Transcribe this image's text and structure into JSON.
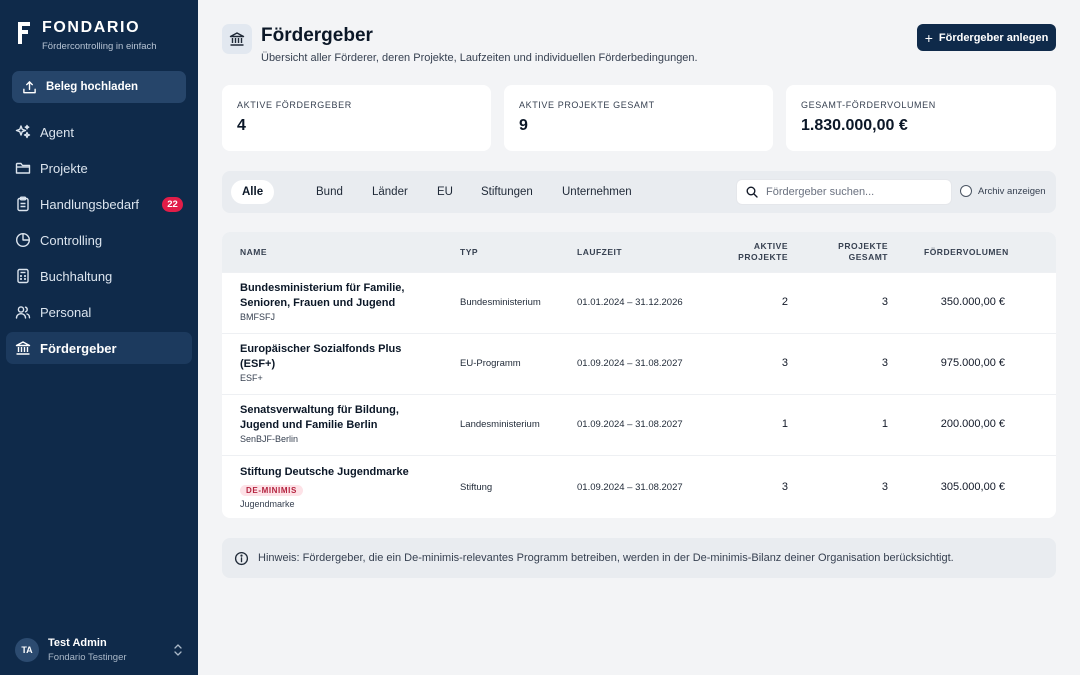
{
  "app": {
    "brand_name": "FONDARIO",
    "brand_tagline": "Fördercontrolling in einfach"
  },
  "sidebar": {
    "upload_label": "Beleg hochladen",
    "items": [
      {
        "label": "Agent",
        "icon": "sparkles-icon"
      },
      {
        "label": "Projekte",
        "icon": "folder-icon"
      },
      {
        "label": "Handlungsbedarf",
        "icon": "clipboard-icon",
        "badge": "22"
      },
      {
        "label": "Controlling",
        "icon": "pie-chart-icon"
      },
      {
        "label": "Buchhaltung",
        "icon": "calculator-icon"
      },
      {
        "label": "Personal",
        "icon": "users-icon"
      },
      {
        "label": "Fördergeber",
        "icon": "bank-icon",
        "active": true
      }
    ],
    "user": {
      "initials": "TA",
      "name": "Test Admin",
      "org": "Fondario Testinger"
    }
  },
  "header": {
    "title": "Fördergeber",
    "subtitle": "Übersicht aller Förderer, deren Projekte, Laufzeiten und individuellen Förderbedingungen.",
    "add_button": "Fördergeber anlegen"
  },
  "stats": [
    {
      "label": "Aktive Fördergeber",
      "value": "4"
    },
    {
      "label": "Aktive Projekte gesamt",
      "value": "9"
    },
    {
      "label": "Gesamt-Fördervolumen",
      "value": "1.830.000,00 €"
    }
  ],
  "filters": {
    "tabs": [
      "Alle",
      "Bund",
      "Länder",
      "EU",
      "Stiftungen",
      "Unternehmen"
    ],
    "active_tab": "Alle",
    "search_placeholder": "Fördergeber suchen...",
    "search_value": "",
    "archive_label": "Archiv anzeigen",
    "archive_checked": false
  },
  "table": {
    "columns": {
      "name": "Name",
      "typ": "Typ",
      "laufzeit": "Laufzeit",
      "aktive_projekte_1": "Aktive",
      "aktive_projekte_2": "Projekte",
      "projekte_gesamt_1": "Projekte",
      "projekte_gesamt_2": "gesamt",
      "volumen": "Fördervolumen"
    },
    "rows": [
      {
        "name_line1": "Bundesministerium für Familie,",
        "name_line2": "Senioren, Frauen und Jugend",
        "badge": "",
        "abbr": "BMFSFJ",
        "typ": "Bundesministerium",
        "laufzeit": "01.01.2024 – 31.12.2026",
        "aktive": "2",
        "gesamt": "3",
        "volumen": "350.000,00 €"
      },
      {
        "name_line1": "Europäischer Sozialfonds Plus",
        "name_line2": "(ESF+)",
        "badge": "",
        "abbr": "ESF+",
        "typ": "EU-Programm",
        "laufzeit": "01.09.2024 – 31.08.2027",
        "aktive": "3",
        "gesamt": "3",
        "volumen": "975.000,00 €"
      },
      {
        "name_line1": "Senatsverwaltung für Bildung,",
        "name_line2": "Jugend und Familie Berlin",
        "badge": "",
        "abbr": "SenBJF-Berlin",
        "typ": "Landesministerium",
        "laufzeit": "01.09.2024 – 31.08.2027",
        "aktive": "1",
        "gesamt": "1",
        "volumen": "200.000,00 €"
      },
      {
        "name_line1": "Stiftung Deutsche Jugendmarke",
        "name_line2": "",
        "badge": "DE-MINIMIS",
        "abbr": "Jugendmarke",
        "typ": "Stiftung",
        "laufzeit": "01.09.2024 – 31.08.2027",
        "aktive": "3",
        "gesamt": "3",
        "volumen": "305.000,00 €"
      }
    ]
  },
  "note": {
    "text": "Hinweis: Fördergeber, die ein De-minimis-relevantes Programm betreiben, werden in der De-minimis-Bilanz deiner Organisation berücksichtigt."
  },
  "colors": {
    "sidebar_bg": "#0f2a4a",
    "primary": "#0f2a4a",
    "badge_red": "#e11d48",
    "deminimis_bg": "#fde2e7",
    "deminimis_text": "#b4233f"
  }
}
